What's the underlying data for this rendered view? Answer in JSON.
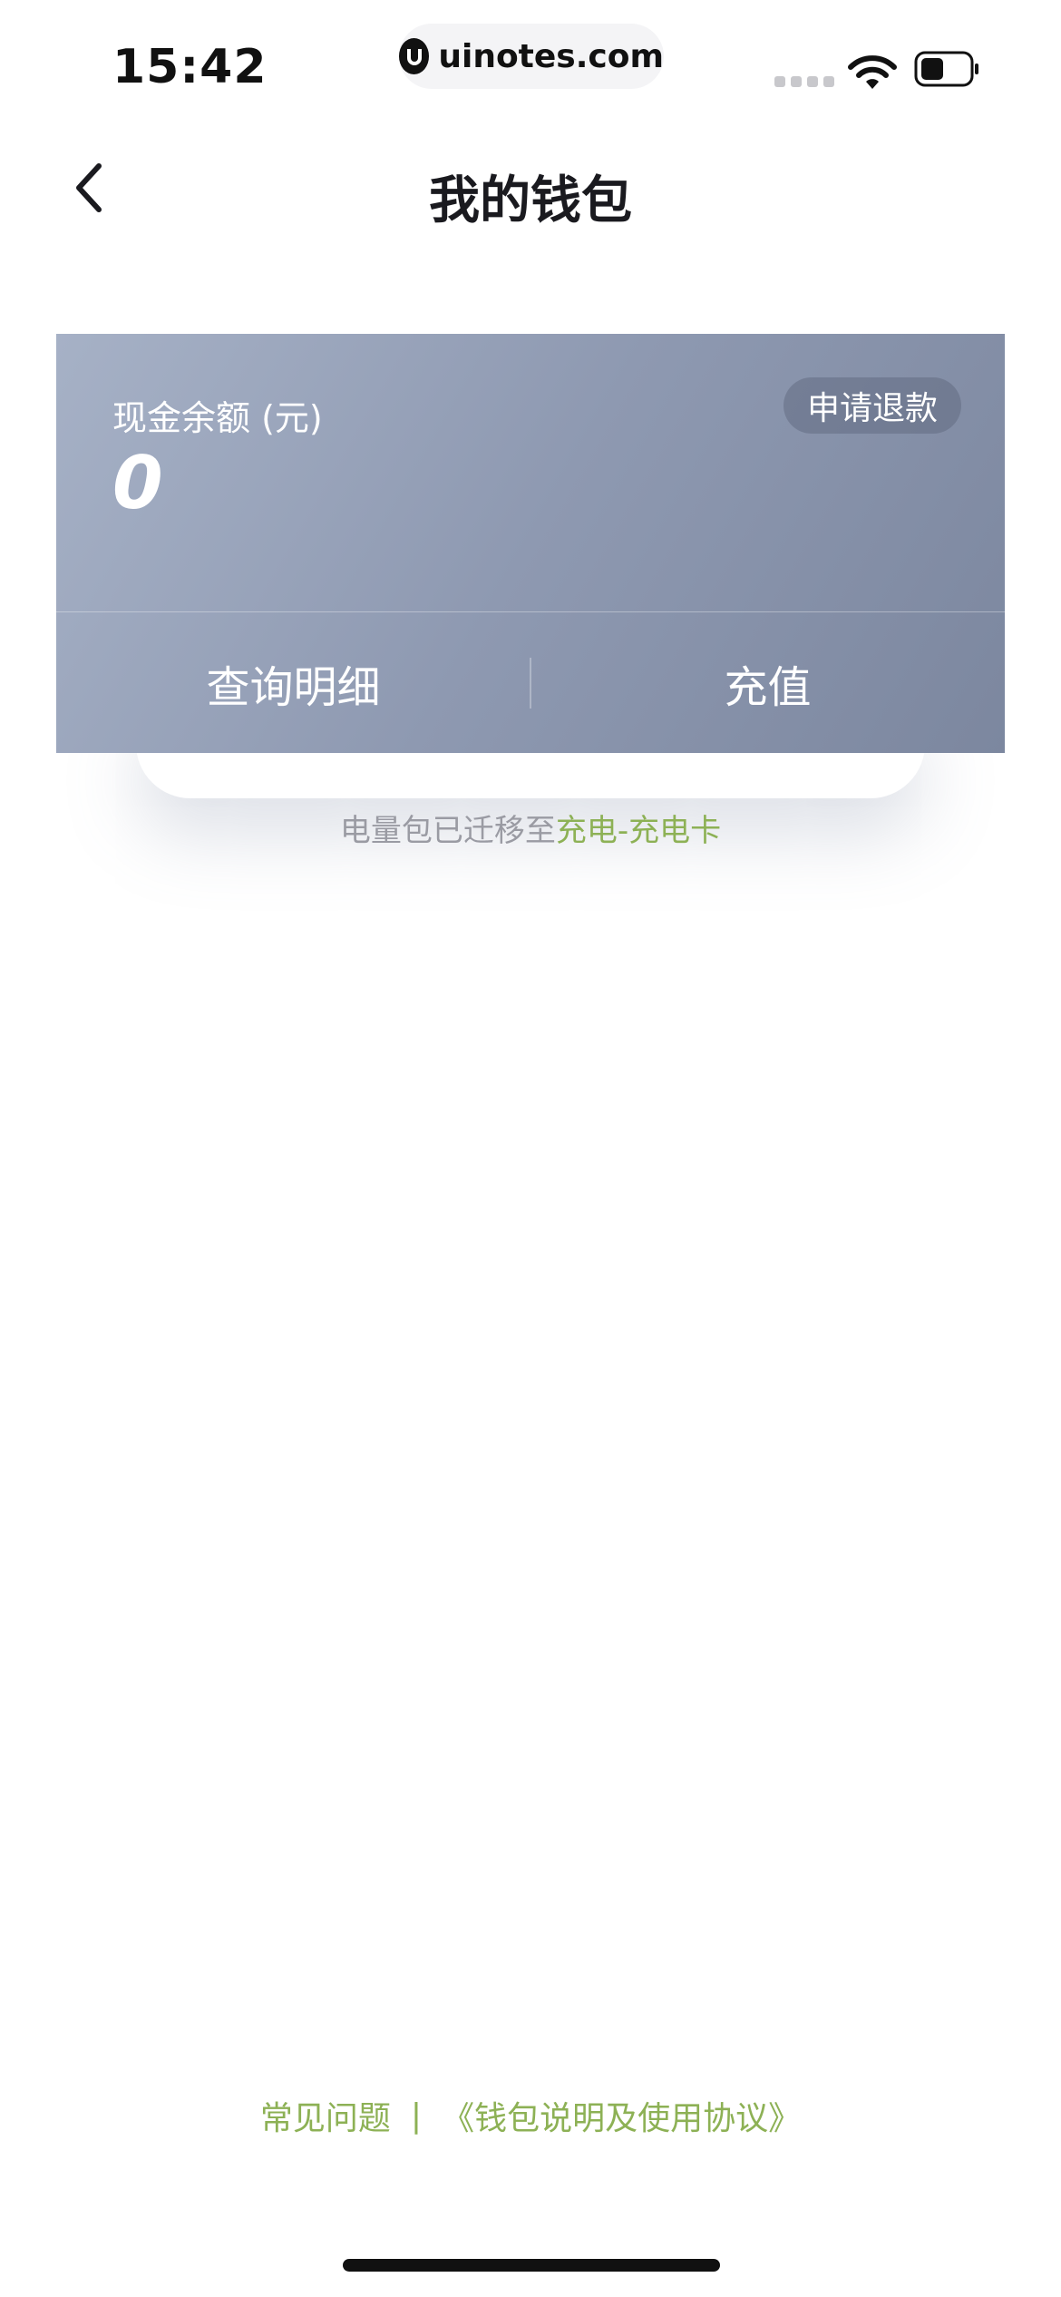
{
  "status_bar": {
    "time": "15:42",
    "url": "uinotes.com"
  },
  "nav": {
    "title": "我的钱包"
  },
  "wallet": {
    "balance_label": "现金余额 (元)",
    "balance_value": "0",
    "refund_label": "申请退款",
    "actions": {
      "details": "查询明细",
      "recharge": "充值"
    }
  },
  "notice": {
    "text": "电量包已迁移至",
    "link": "充电-充电卡"
  },
  "footer": {
    "faq": "常见问题",
    "separator": "|",
    "agreement": "《钱包说明及使用协议》"
  },
  "colors": {
    "accent_green": "#8db155",
    "card_start": "#a6b1c6",
    "card_end": "#7c879f"
  }
}
